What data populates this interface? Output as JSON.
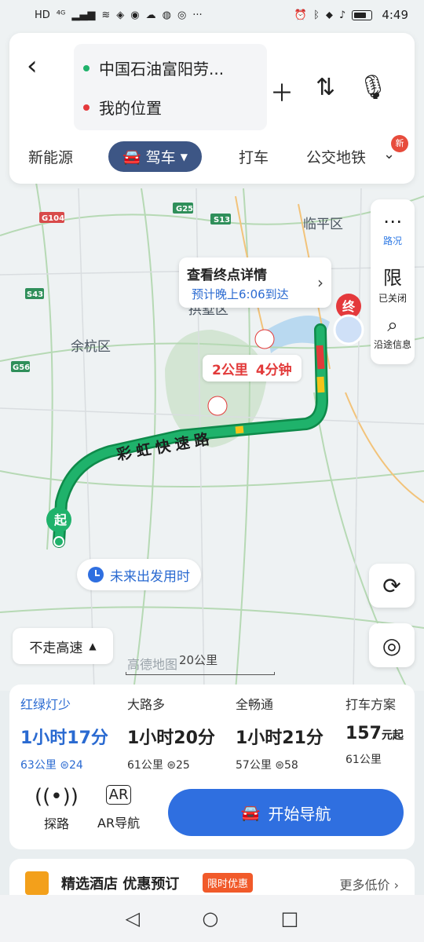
{
  "status_bar": {
    "left_icons": [
      "HD",
      "4G",
      "signal-icon",
      "wifi-icon",
      "shield-icon",
      "person-icon",
      "cloud-icon",
      "app-icon",
      "app-icon",
      "more-icon"
    ],
    "time": "4:49"
  },
  "search": {
    "from": "中国石油富阳劳...",
    "to": "我的位置"
  },
  "tabs": [
    {
      "label": "新能源"
    },
    {
      "label": "驾车",
      "active": true
    },
    {
      "label": "打车"
    },
    {
      "label": "公交地铁"
    }
  ],
  "new_badge": "新",
  "side_tools": {
    "traffic": "路况",
    "restrict_icon": "限",
    "restrict": "已关闭",
    "along_route": "沿途信息"
  },
  "map": {
    "labels": {
      "g104": "G104",
      "g25": "G25",
      "s13": "S13",
      "s43": "S43",
      "g56": "G56",
      "linping": "临平区",
      "yuhang": "余杭区",
      "gongshu": "拱墅区",
      "road_name": "彩虹快速路",
      "start_mark": "起",
      "end_mark": "终"
    },
    "dest_bubble_title": "查看终点详情",
    "dest_bubble_eta": "预计晚上6:06到达",
    "route_distance": "2公里",
    "route_time": "4分钟",
    "future_departure": "未来出发用时",
    "no_highway": "不走高速",
    "scale": "20公里",
    "watermark": "高德地图"
  },
  "options": [
    {
      "name": "红绿灯少",
      "duration": "1小时17分",
      "distance": "63公里",
      "lights": "24",
      "selected": true
    },
    {
      "name": "大路多",
      "duration": "1小时20分",
      "distance": "61公里",
      "lights": "25"
    },
    {
      "name": "全畅通",
      "duration": "1小时21分",
      "distance": "57公里",
      "lights": "58"
    },
    {
      "name": "打车方案",
      "price": "157",
      "price_unit": "元起",
      "distance": "61公里"
    }
  ],
  "panel_tools": {
    "explore": "探路",
    "ar": "AR导航",
    "start": "开始导航"
  },
  "hotel": {
    "title": "精选酒店 优惠预订",
    "tag": "限时优惠",
    "more": "更多低价"
  },
  "colors": {
    "accent": "#2f6fe0",
    "route_green": "#1fb26b",
    "route_border": "#0e8a4a",
    "tab_active": "#3d5685"
  }
}
